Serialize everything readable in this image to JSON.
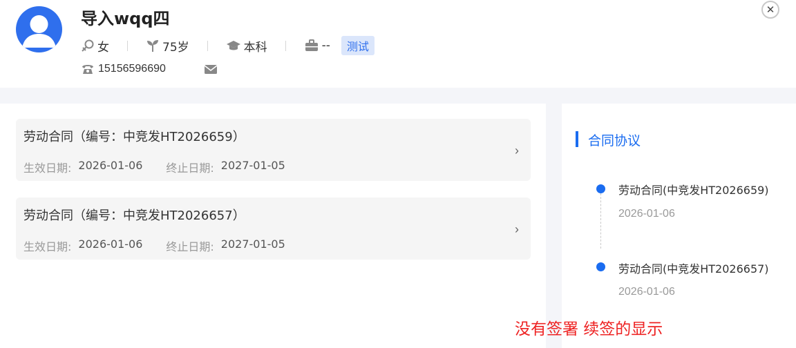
{
  "profile": {
    "name": "导入wqq四",
    "gender": "女",
    "age": "75岁",
    "education": "本科",
    "job": "--",
    "tag": "测试",
    "phone": "15156596690"
  },
  "contracts": [
    {
      "title": "劳动合同（编号：中竞发HT2026659）",
      "start_label": "生效日期:",
      "start_date": "2026-01-06",
      "end_label": "终止日期:",
      "end_date": "2027-01-05"
    },
    {
      "title": "劳动合同（编号：中竞发HT2026657）",
      "start_label": "生效日期:",
      "start_date": "2026-01-06",
      "end_label": "终止日期:",
      "end_date": "2027-01-05"
    }
  ],
  "sidebar": {
    "title": "合同协议",
    "timeline": [
      {
        "title": "劳动合同(中竞发HT2026659)",
        "date": "2026-01-06"
      },
      {
        "title": "劳动合同(中竞发HT2026657)",
        "date": "2026-01-06"
      }
    ]
  },
  "annotation": "没有签署 续签的显示",
  "colors": {
    "accent": "#1a6cf0",
    "avatar": "#2f6fed",
    "annotation": "#ee2222",
    "tag_bg": "#dbe6fb"
  },
  "icons": [
    "avatar-icon",
    "close-icon",
    "gender-icon",
    "age-sprout-icon",
    "graduation-cap-icon",
    "briefcase-icon",
    "phone-icon",
    "mail-icon",
    "chevron-right-icon"
  ]
}
